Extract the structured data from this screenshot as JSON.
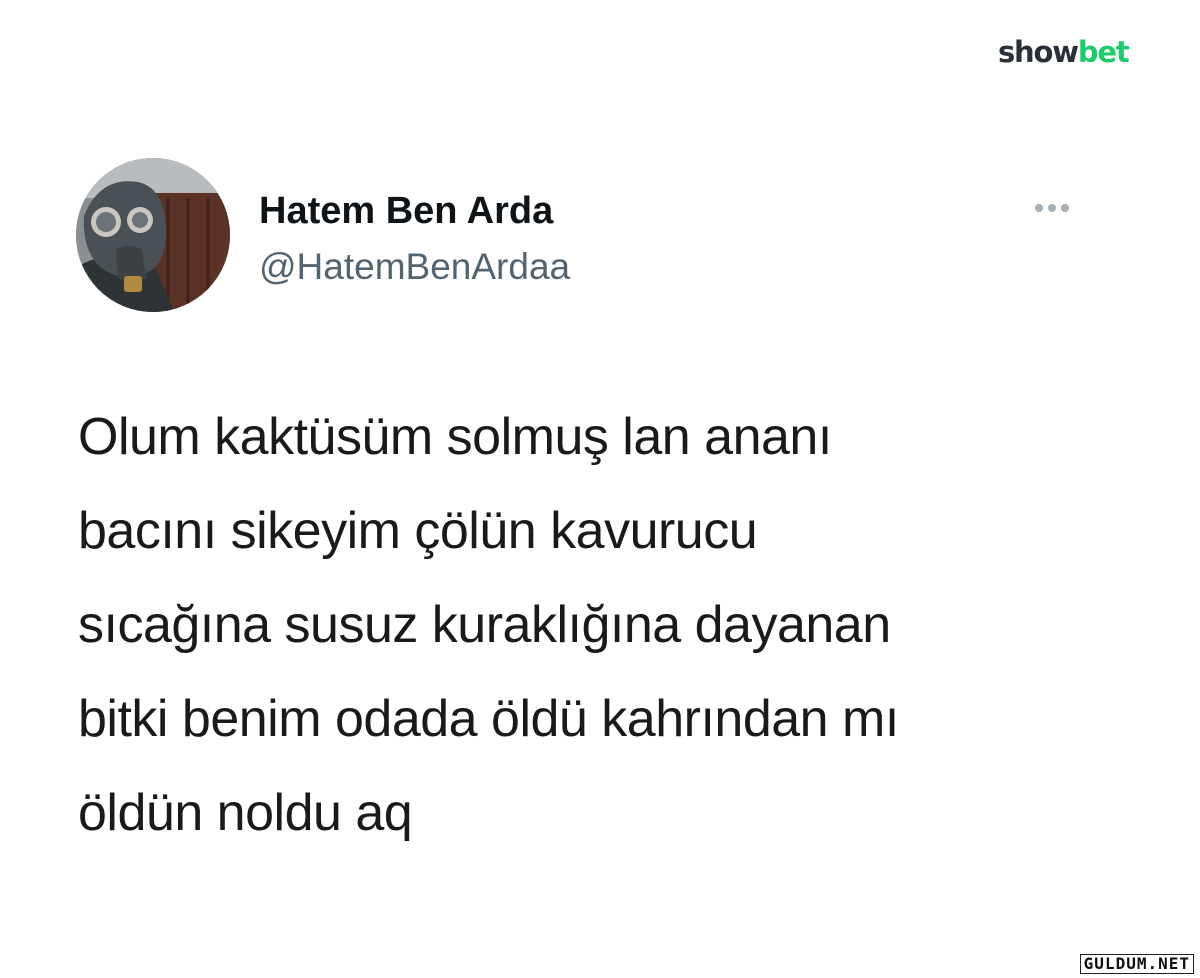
{
  "branding": {
    "watermark_part1": "show",
    "watermark_part2": "bet",
    "bottom_watermark": "GULDUM.NET",
    "accent_color": "#1ecb6b",
    "dark_color": "#2a2f3a"
  },
  "tweet": {
    "author_name": "Hatem Ben Arda",
    "author_handle": "@HatemBenArdaa",
    "more_icon": "more-horizontal-icon",
    "avatar_icon": "gas-mask-avatar",
    "text": "Olum kaktüsüm solmuş lan ananı\nbacını sikeyim çölün kavurucu\nsıcağına susuz kuraklığına dayanan\nbitki benim odada öldü kahrından mı\nöldün noldu aq"
  }
}
